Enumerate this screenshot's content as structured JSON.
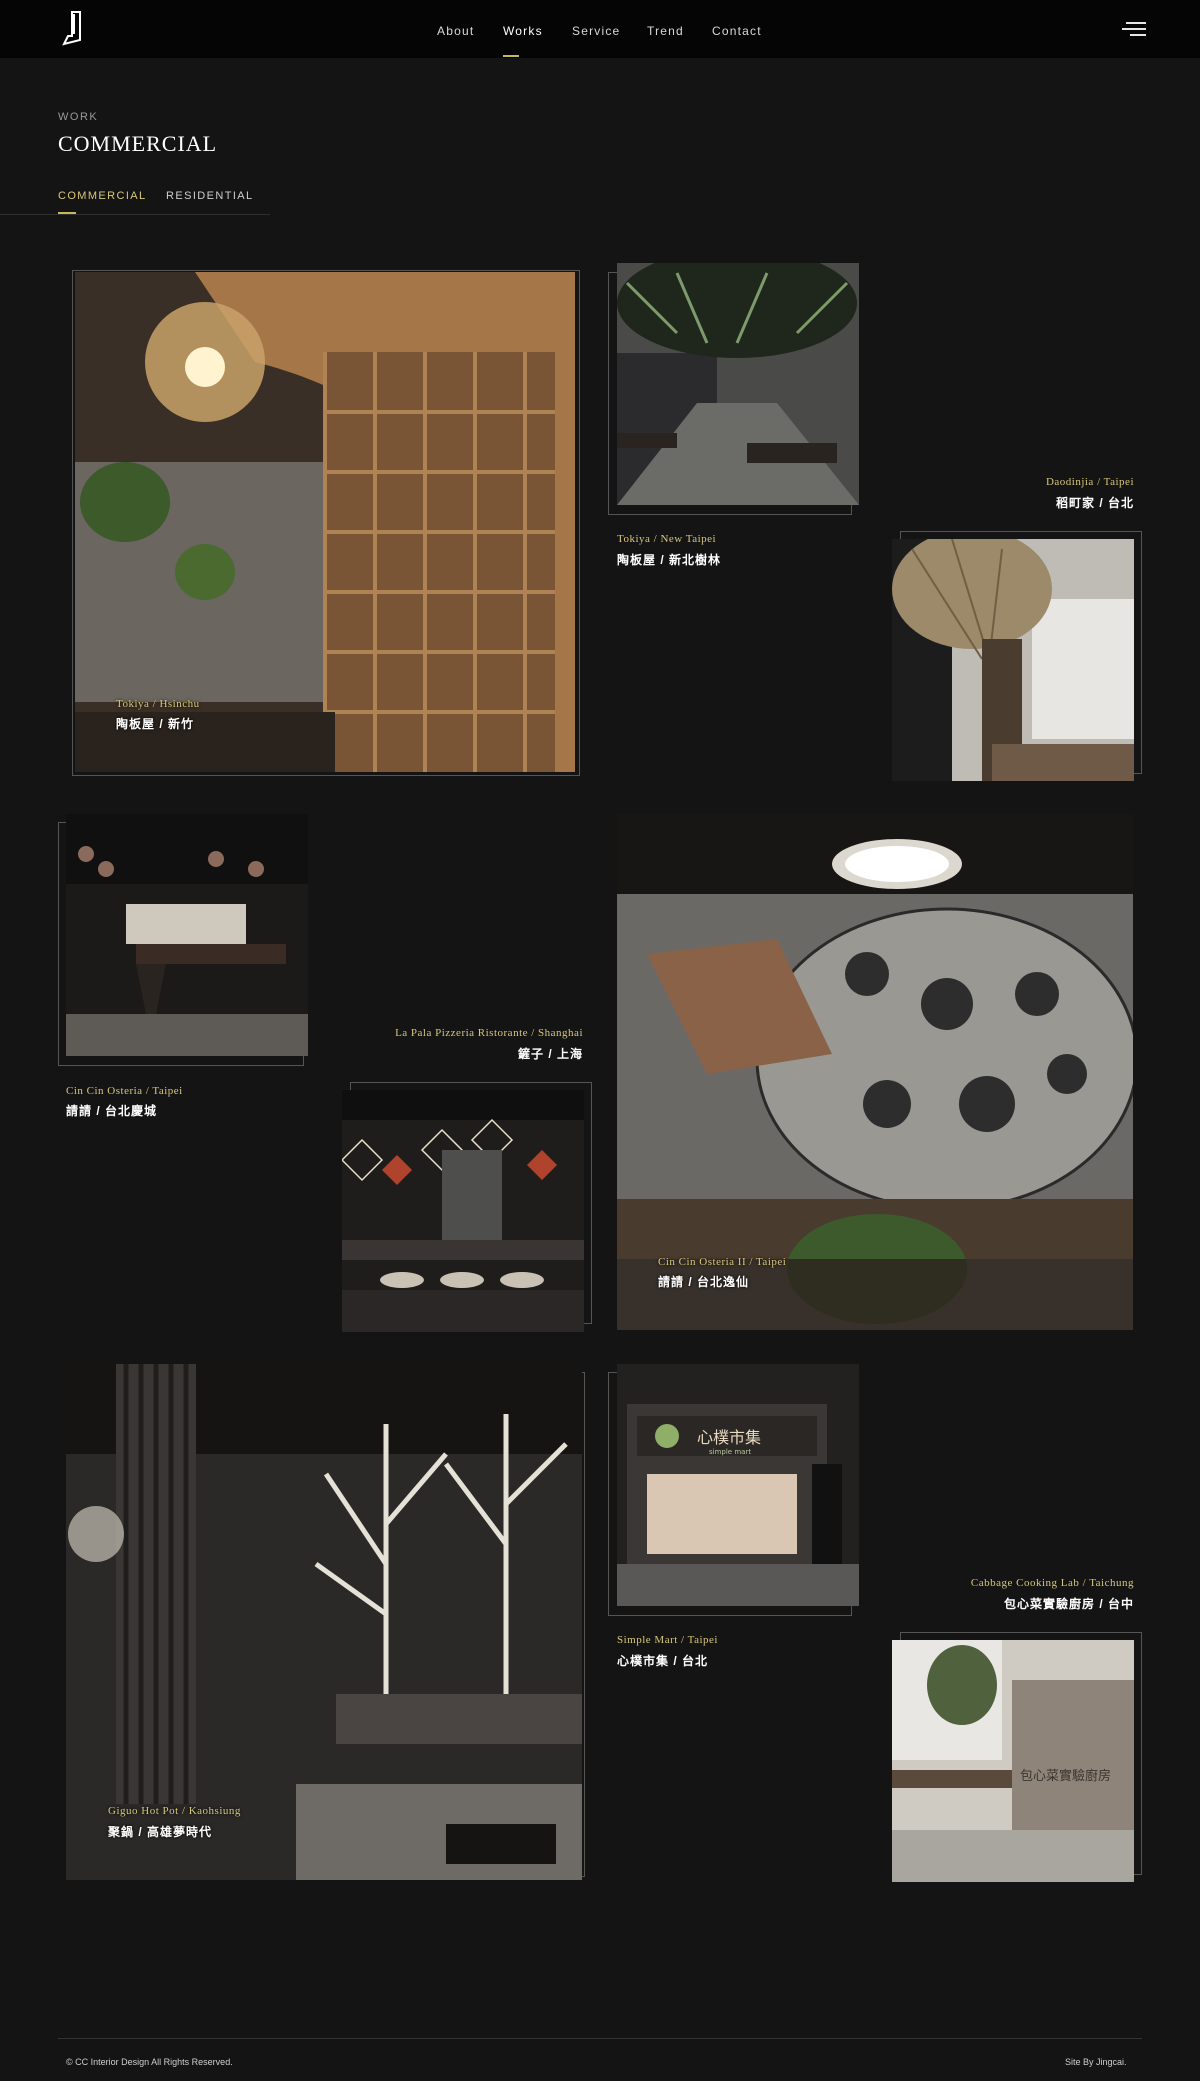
{
  "nav": {
    "items": [
      {
        "label": "About"
      },
      {
        "label": "Works"
      },
      {
        "label": "Service"
      },
      {
        "label": "Trend"
      },
      {
        "label": "Contact"
      }
    ]
  },
  "heading": {
    "kicker": "WORK",
    "title": "COMMERCIAL"
  },
  "tabs": [
    {
      "label": "COMMERCIAL"
    },
    {
      "label": "RESIDENTIAL"
    }
  ],
  "projects": [
    {
      "en": "Tokiya / Hsinchu",
      "zh": "陶板屋 / 新竹"
    },
    {
      "en": "Tokiya / New Taipei",
      "zh": "陶板屋 / 新北樹林"
    },
    {
      "en": "Daodinjia / Taipei",
      "zh": "稻町家 / 台北"
    },
    {
      "en": "Cin Cin Osteria / Taipei",
      "zh": "請請 / 台北慶城"
    },
    {
      "en": "La Pala Pizzeria Ristorante / Shanghai",
      "zh": "鏟子 / 上海"
    },
    {
      "en": "Cin Cin Osteria II / Taipei",
      "zh": "請請 / 台北逸仙"
    },
    {
      "en": "Giguo Hot Pot / Kaohsiung",
      "zh": "聚鍋 / 高雄夢時代"
    },
    {
      "en": "Simple Mart / Taipei",
      "zh": "心樸市集 / 台北"
    },
    {
      "en": "Cabbage Cooking Lab / Taichung",
      "zh": "包心菜實驗廚房 / 台中"
    }
  ],
  "signage": {
    "store": "心樸市集",
    "store_en": "simple mart",
    "kitchen": "包心菜實驗廚房"
  },
  "footer": {
    "copyright": "© CC Interior Design All Rights Reserved.",
    "site": "Site By Jingcai."
  }
}
